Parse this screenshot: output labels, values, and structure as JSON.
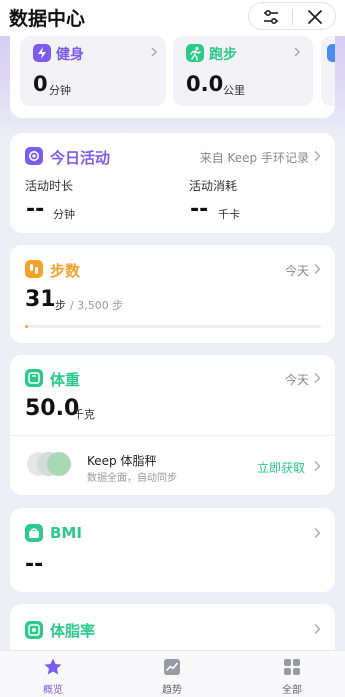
{
  "header": {
    "title": "数据中心"
  },
  "quick": [
    {
      "label": "健身",
      "value": "0",
      "unit": "分钟",
      "color": "#7b5cf0"
    },
    {
      "label": "跑步",
      "value": "0.0",
      "unit": "公里",
      "color": "#2cc98a"
    }
  ],
  "activity": {
    "title": "今日活动",
    "source": "来自 Keep 手环记录",
    "color": "#7b5cf0",
    "duration_label": "活动时长",
    "duration_value": "--",
    "duration_unit": "分钟",
    "burn_label": "活动消耗",
    "burn_value": "--",
    "burn_unit": "千卡"
  },
  "steps": {
    "title": "步数",
    "date": "今天",
    "color": "#f5a22c",
    "value": "31",
    "unit": "步",
    "goal": "/ 3,500 步",
    "progress": 0.009
  },
  "weight": {
    "title": "体重",
    "date": "今天",
    "color": "#2cc98a",
    "value": "50.0",
    "unit": "千克",
    "scale_name": "Keep 体脂秤",
    "scale_desc": "数据全面，自动同步",
    "scale_action": "立即获取"
  },
  "bmi": {
    "title": "BMI",
    "value": "--",
    "color": "#2cc98a"
  },
  "bodyfat": {
    "title": "体脂率",
    "color": "#2cc98a"
  },
  "tabs": [
    {
      "label": "概览",
      "icon": "star-icon",
      "active": true
    },
    {
      "label": "趋势",
      "icon": "trend-icon",
      "active": false
    },
    {
      "label": "全部",
      "icon": "grid-icon",
      "active": false
    }
  ],
  "colors": {
    "accent": "#7b5cf0",
    "green": "#2cc98a",
    "orange": "#f5a22c"
  }
}
